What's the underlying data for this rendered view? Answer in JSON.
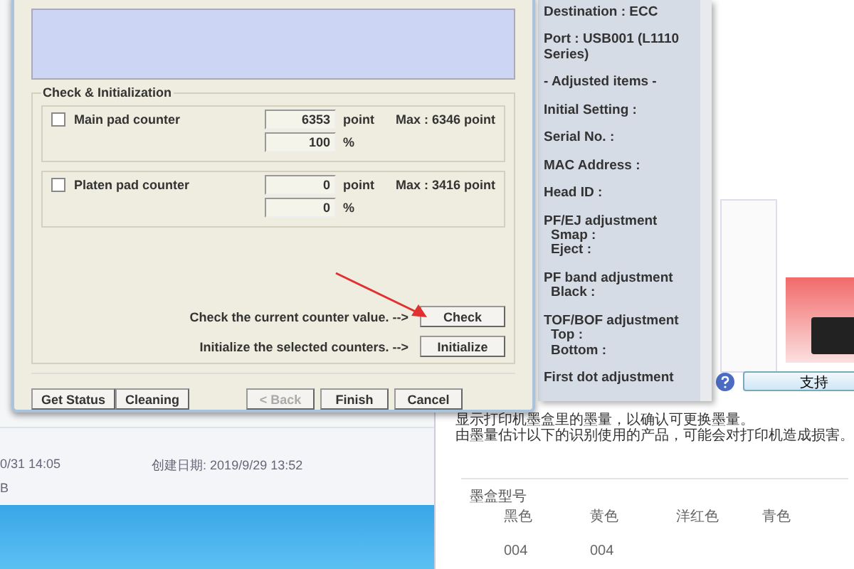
{
  "explorer": {
    "modified": "0/31 14:05",
    "created": "创建日期: 2019/9/29 13:52",
    "size": "B"
  },
  "printer_window": {
    "support_button": "支持",
    "notice": [
      "显示打印机墨盒里的墨量，以确认可更换墨量。",
      "由墨量估计以下的识别使用的产品，可能会对打印机造成损害。"
    ],
    "ink": {
      "title": "墨盒型号",
      "columns": [
        {
          "name": "黑色",
          "code": "004"
        },
        {
          "name": "黄色",
          "code": "004"
        },
        {
          "name": "洋红色"
        },
        {
          "name": "青色"
        }
      ]
    }
  },
  "info_panel": {
    "lines": [
      {
        "text": "Destination : ECC"
      },
      {
        "text": "Port : USB001 (L1110 Series)"
      },
      {
        "text": "- Adjusted items -"
      },
      {
        "text": "Initial Setting :"
      },
      {
        "text": "Serial No. :"
      },
      {
        "text": "MAC Address :"
      },
      {
        "text": "Head ID :"
      },
      {
        "text": "PF/EJ adjustment",
        "children": [
          {
            "text": "Smap :"
          },
          {
            "text": "Eject :"
          }
        ]
      },
      {
        "text": "PF band adjustment",
        "children": [
          {
            "text": "Black :"
          }
        ]
      },
      {
        "text": "TOF/BOF adjustment",
        "children": [
          {
            "text": "Top :"
          },
          {
            "text": "Bottom :"
          }
        ]
      },
      {
        "text": "First dot adjustment"
      }
    ]
  },
  "dialog": {
    "group_title": "Check & Initialization",
    "counters": [
      {
        "label": "Main pad counter",
        "checked": false,
        "value": "6353",
        "unit": "point",
        "max": "Max : 6346 point",
        "percent": "100",
        "percent_unit": "%"
      },
      {
        "label": "Platen pad counter",
        "checked": false,
        "value": "0",
        "unit": "point",
        "max": "Max : 3416 point",
        "percent": "0",
        "percent_unit": "%"
      }
    ],
    "actions": [
      {
        "hint": "Check the current counter value. -->",
        "button": "Check"
      },
      {
        "hint": "Initialize the selected counters. -->",
        "button": "Initialize"
      }
    ],
    "left_buttons": [
      {
        "label": "Get Status",
        "disabled": false
      },
      {
        "label": "Cleaning",
        "disabled": false
      }
    ],
    "nav_buttons": [
      {
        "label": "< Back",
        "disabled": true
      },
      {
        "label": "Finish",
        "disabled": false
      },
      {
        "label": "Cancel",
        "disabled": false
      }
    ]
  }
}
